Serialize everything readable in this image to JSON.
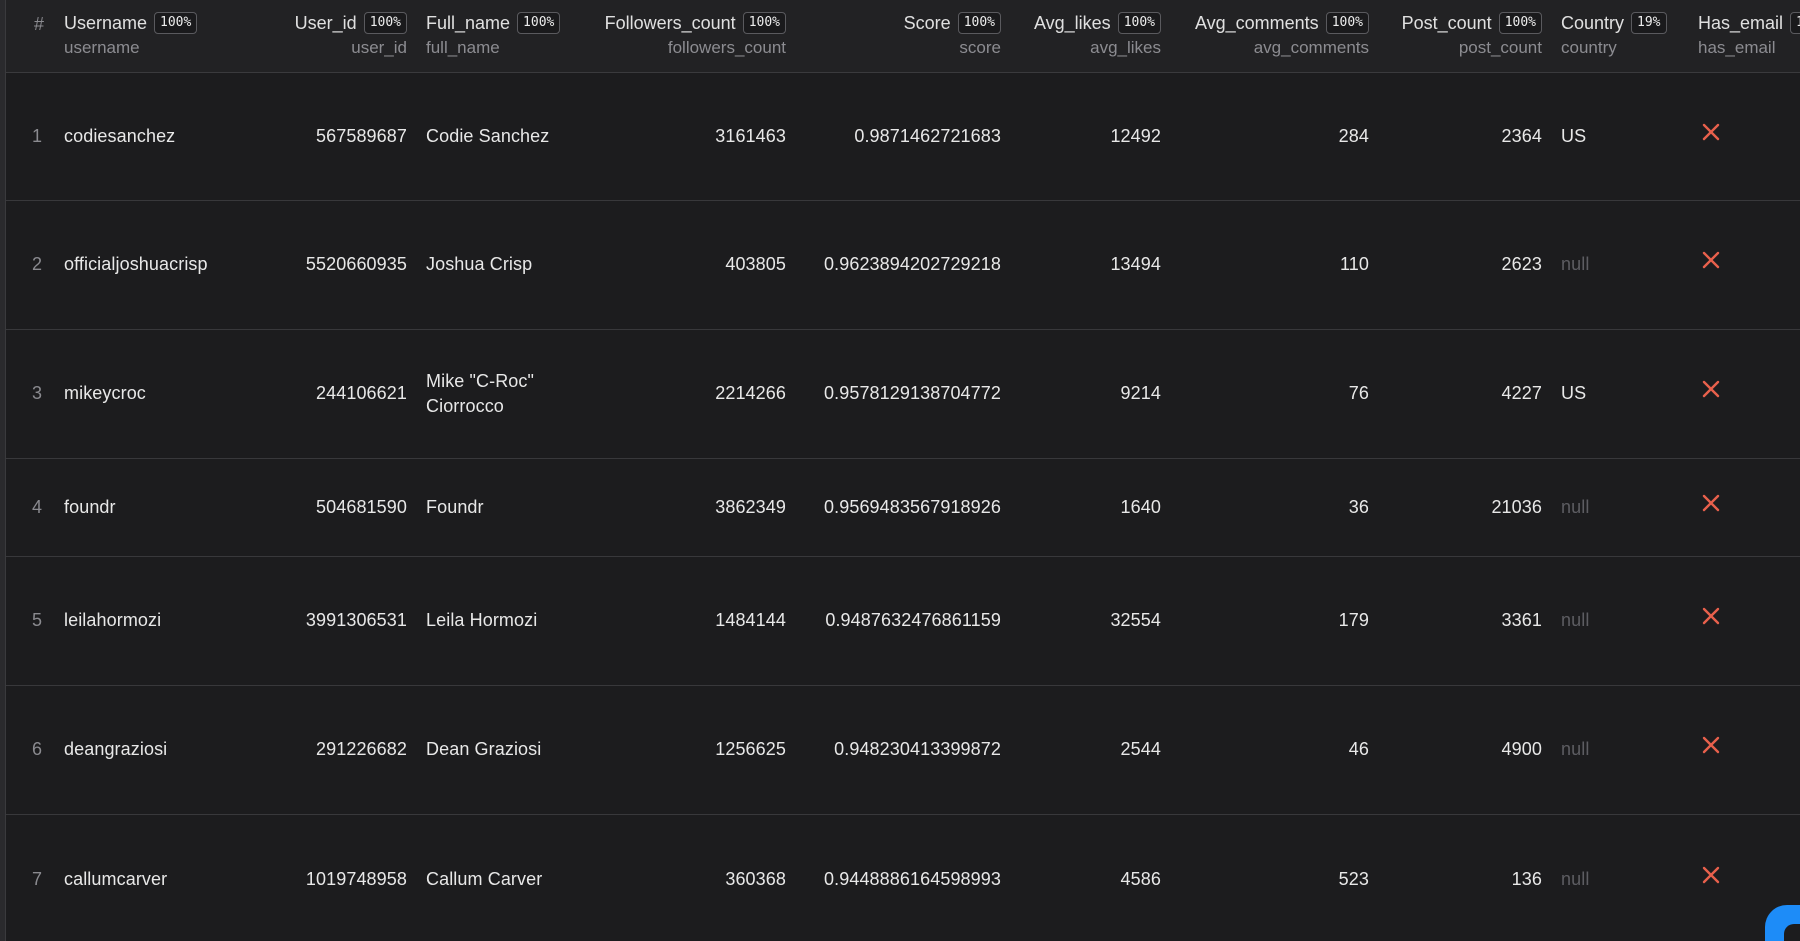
{
  "table": {
    "row_index_header": "#",
    "columns": [
      {
        "key": "username",
        "label": "Username",
        "completeness": "100%",
        "sub": "username"
      },
      {
        "key": "user_id",
        "label": "User_id",
        "completeness": "100%",
        "sub": "user_id"
      },
      {
        "key": "full_name",
        "label": "Full_name",
        "completeness": "100%",
        "sub": "full_name"
      },
      {
        "key": "followers_count",
        "label": "Followers_count",
        "completeness": "100%",
        "sub": "followers_count"
      },
      {
        "key": "score",
        "label": "Score",
        "completeness": "100%",
        "sub": "score"
      },
      {
        "key": "avg_likes",
        "label": "Avg_likes",
        "completeness": "100%",
        "sub": "avg_likes"
      },
      {
        "key": "avg_comments",
        "label": "Avg_comments",
        "completeness": "100%",
        "sub": "avg_comments"
      },
      {
        "key": "post_count",
        "label": "Post_count",
        "completeness": "100%",
        "sub": "post_count"
      },
      {
        "key": "country",
        "label": "Country",
        "completeness": "19%",
        "sub": "country"
      },
      {
        "key": "has_email",
        "label": "Has_email",
        "completeness": "1",
        "sub": "has_email"
      }
    ],
    "rows": [
      {
        "n": "1",
        "username": "codiesanchez",
        "user_id": "567589687",
        "full_name": "Codie Sanchez",
        "followers_count": "3161463",
        "score": "0.9871462721683",
        "avg_likes": "12492",
        "avg_comments": "284",
        "post_count": "2364",
        "country": "US",
        "has_email": "false"
      },
      {
        "n": "2",
        "username": "officialjoshuacrisp",
        "user_id": "5520660935",
        "full_name": "Joshua Crisp",
        "followers_count": "403805",
        "score": "0.9623894202729218",
        "avg_likes": "13494",
        "avg_comments": "110",
        "post_count": "2623",
        "country": "null",
        "has_email": "false"
      },
      {
        "n": "3",
        "username": "mikeycroc",
        "user_id": "244106621",
        "full_name": "Mike \"C-Roc\" Ciorrocco",
        "followers_count": "2214266",
        "score": "0.9578129138704772",
        "avg_likes": "9214",
        "avg_comments": "76",
        "post_count": "4227",
        "country": "US",
        "has_email": "false"
      },
      {
        "n": "4",
        "username": "foundr",
        "user_id": "504681590",
        "full_name": "Foundr",
        "followers_count": "3862349",
        "score": "0.9569483567918926",
        "avg_likes": "1640",
        "avg_comments": "36",
        "post_count": "21036",
        "country": "null",
        "has_email": "false"
      },
      {
        "n": "5",
        "username": "leilahormozi",
        "user_id": "3991306531",
        "full_name": "Leila Hormozi",
        "followers_count": "1484144",
        "score": "0.9487632476861159",
        "avg_likes": "32554",
        "avg_comments": "179",
        "post_count": "3361",
        "country": "null",
        "has_email": "false"
      },
      {
        "n": "6",
        "username": "deangraziosi",
        "user_id": "291226682",
        "full_name": "Dean Graziosi",
        "followers_count": "1256625",
        "score": "0.948230413399872",
        "avg_likes": "2544",
        "avg_comments": "46",
        "post_count": "4900",
        "country": "null",
        "has_email": "false"
      },
      {
        "n": "7",
        "username": "callumcarver",
        "user_id": "1019748958",
        "full_name": "Callum Carver",
        "followers_count": "360368",
        "score": "0.9448886164598993",
        "avg_likes": "4586",
        "avg_comments": "523",
        "post_count": "136",
        "country": "null",
        "has_email": "false"
      }
    ]
  },
  "colors": {
    "background": "#1c1c1e",
    "false_icon": "#e8604c",
    "corner_button": "#1d8cf8"
  },
  "icons": {
    "has_email_false": "close-x-icon",
    "corner": "chat-widget-icon"
  }
}
